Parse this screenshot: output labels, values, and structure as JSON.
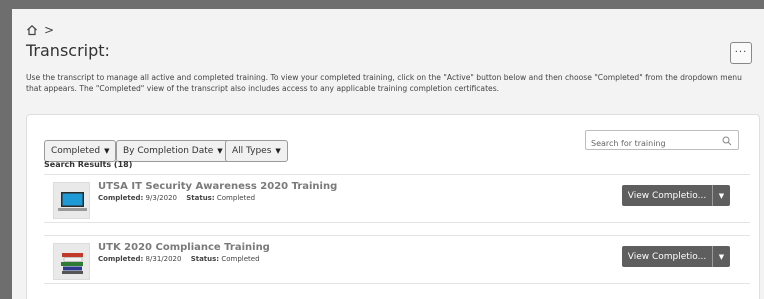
{
  "breadcrumb": {
    "separator": ">",
    "home_icon": "home-icon"
  },
  "header": {
    "title": "Transcript:",
    "more_label": "···"
  },
  "description": "Use the transcript to manage all active and completed training. To view your completed training, click on the \"Active\" button below and then choose \"Completed\" from the dropdown menu that appears. The \"Completed\" view of the transcript also includes access to any applicable training completion certificates.",
  "filters": {
    "status": "Completed",
    "sort": "By Completion Date",
    "type": "All Types"
  },
  "search": {
    "placeholder": "Search for training",
    "icon": "search-icon"
  },
  "results_label": "Search Results (18)",
  "items": [
    {
      "title": "UTSA IT Security Awareness 2020 Training",
      "completed_label": "Completed:",
      "completed_date": "9/3/2020",
      "status_label": "Status:",
      "status_value": "Completed",
      "action_label": "View Completio...",
      "thumb_icon": "laptop-icon"
    },
    {
      "title": "UTK 2020 Compliance Training",
      "completed_label": "Completed:",
      "completed_date": "8/31/2020",
      "status_label": "Status:",
      "status_value": "Completed",
      "action_label": "View Completio...",
      "thumb_icon": "books-icon"
    }
  ]
}
